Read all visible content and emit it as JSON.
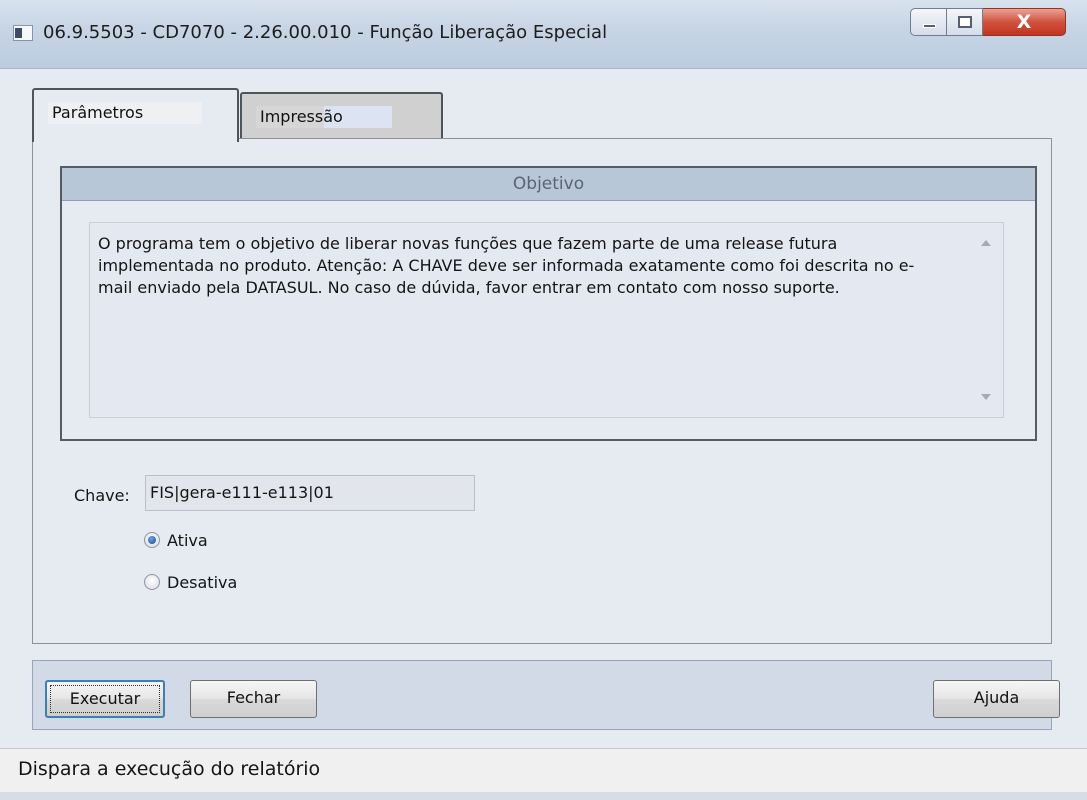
{
  "window": {
    "title": "06.9.5503 - CD7070 - 2.26.00.010 - Função Liberação Especial",
    "close_glyph": "X"
  },
  "tabs": [
    {
      "label": "Parâmetros",
      "active": true
    },
    {
      "label": "Impressão",
      "active": false
    }
  ],
  "objetivo": {
    "header": "Objetivo",
    "text": "O programa tem o objetivo de liberar novas funções que fazem parte de uma release futura implementada no produto. Atenção: A CHAVE deve ser informada exatamente como foi descrita no e-mail enviado pela DATASUL. No caso de dúvida, favor entrar em contato com nosso suporte."
  },
  "chave": {
    "label": "Chave:",
    "value": "FIS|gera-e111-e113|01"
  },
  "options": [
    {
      "label": "Ativa",
      "checked": true
    },
    {
      "label": "Desativa",
      "checked": false
    }
  ],
  "buttons": {
    "executar": "Executar",
    "fechar": "Fechar",
    "ajuda": "Ajuda"
  },
  "status": {
    "text": "Dispara a execução do relatório"
  },
  "colors": {
    "header_bg": "#b8c7d8",
    "window_bg": "#e6ebf2",
    "close_red": "#c2341f"
  }
}
